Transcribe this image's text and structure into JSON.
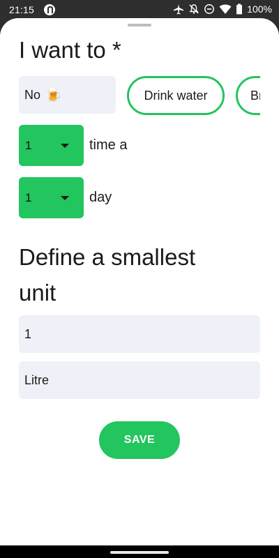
{
  "status_bar": {
    "time": "21:15",
    "battery": "100%",
    "icons": [
      "app-notification-icon",
      "airplane-icon",
      "notifications-off-icon",
      "do-not-disturb-icon",
      "wifi-icon",
      "battery-icon"
    ]
  },
  "form": {
    "title": "I want to *",
    "choices": [
      {
        "label": "No",
        "emoji": "🍺",
        "selected": false
      },
      {
        "label": "Drink water",
        "selected": true
      },
      {
        "label": "Br",
        "selected": true
      }
    ],
    "times": {
      "value": "1",
      "label": "time a"
    },
    "period": {
      "value": "1",
      "label": "day"
    },
    "section_title": "Define a smallest unit",
    "amount_value": "1",
    "unit_value": "Litre",
    "save_label": "SAVE"
  },
  "colors": {
    "accent": "#22c55e",
    "field_background": "#eef1f7",
    "sheet_background": "#ffffff",
    "status_bar": "#2e2e2e"
  }
}
